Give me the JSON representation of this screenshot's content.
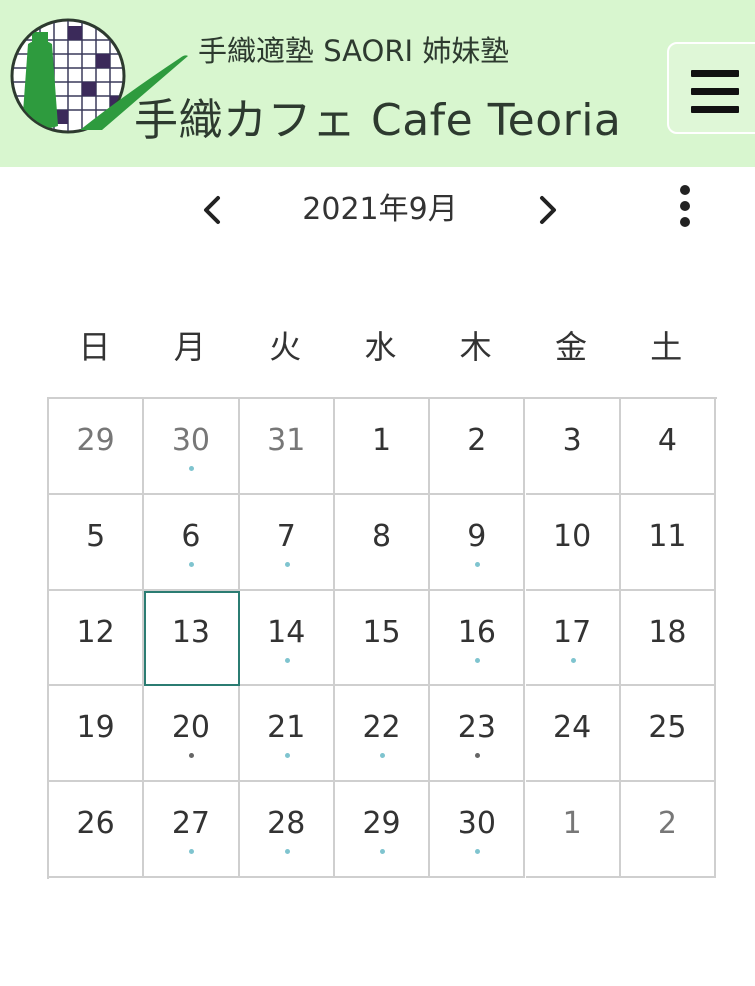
{
  "header": {
    "subtitle": "手織適塾 SAORI 姉妹塾",
    "title": "手織カフェ Cafe Teoria",
    "logo_icon": "loom-logo-icon",
    "menu_icon": "hamburger-menu-icon",
    "background": "#d8f6cf"
  },
  "calendar": {
    "month_label": "2021年9月",
    "prev_icon": "chevron-left-icon",
    "next_icon": "chevron-right-icon",
    "more_icon": "more-vertical-icon",
    "weekdays": [
      "日",
      "月",
      "火",
      "水",
      "木",
      "金",
      "土"
    ],
    "today": "13",
    "event_dot_color": "#7fc4cf",
    "weeks": [
      [
        {
          "day": "29",
          "other": true,
          "dot": ""
        },
        {
          "day": "30",
          "other": true,
          "dot": "teal"
        },
        {
          "day": "31",
          "other": true,
          "dot": ""
        },
        {
          "day": "1",
          "other": false,
          "dot": ""
        },
        {
          "day": "2",
          "other": false,
          "dot": ""
        },
        {
          "day": "3",
          "other": false,
          "dot": ""
        },
        {
          "day": "4",
          "other": false,
          "dot": ""
        }
      ],
      [
        {
          "day": "5",
          "other": false,
          "dot": ""
        },
        {
          "day": "6",
          "other": false,
          "dot": "teal"
        },
        {
          "day": "7",
          "other": false,
          "dot": "teal"
        },
        {
          "day": "8",
          "other": false,
          "dot": ""
        },
        {
          "day": "9",
          "other": false,
          "dot": "teal"
        },
        {
          "day": "10",
          "other": false,
          "dot": ""
        },
        {
          "day": "11",
          "other": false,
          "dot": ""
        }
      ],
      [
        {
          "day": "12",
          "other": false,
          "dot": ""
        },
        {
          "day": "13",
          "other": false,
          "dot": "",
          "today": true
        },
        {
          "day": "14",
          "other": false,
          "dot": "teal"
        },
        {
          "day": "15",
          "other": false,
          "dot": ""
        },
        {
          "day": "16",
          "other": false,
          "dot": "teal"
        },
        {
          "day": "17",
          "other": false,
          "dot": "teal"
        },
        {
          "day": "18",
          "other": false,
          "dot": ""
        }
      ],
      [
        {
          "day": "19",
          "other": false,
          "dot": ""
        },
        {
          "day": "20",
          "other": false,
          "dot": "gray"
        },
        {
          "day": "21",
          "other": false,
          "dot": "teal"
        },
        {
          "day": "22",
          "other": false,
          "dot": "teal"
        },
        {
          "day": "23",
          "other": false,
          "dot": "gray"
        },
        {
          "day": "24",
          "other": false,
          "dot": ""
        },
        {
          "day": "25",
          "other": false,
          "dot": ""
        }
      ],
      [
        {
          "day": "26",
          "other": false,
          "dot": ""
        },
        {
          "day": "27",
          "other": false,
          "dot": "teal"
        },
        {
          "day": "28",
          "other": false,
          "dot": "teal"
        },
        {
          "day": "29",
          "other": false,
          "dot": "teal"
        },
        {
          "day": "30",
          "other": false,
          "dot": "teal"
        },
        {
          "day": "1",
          "other": true,
          "dot": ""
        },
        {
          "day": "2",
          "other": true,
          "dot": ""
        }
      ]
    ]
  }
}
